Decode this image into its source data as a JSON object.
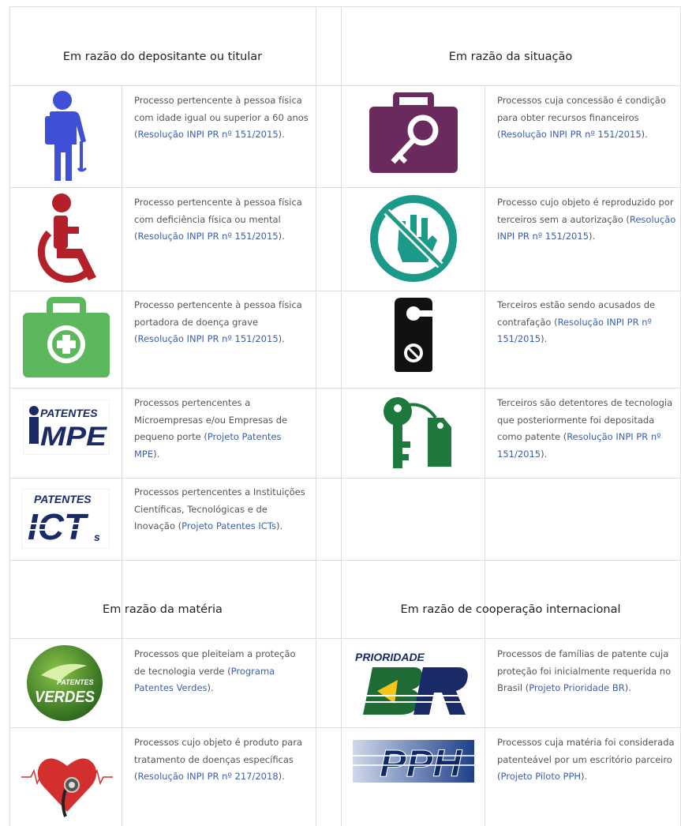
{
  "headers": {
    "depositante": "Em razão do depositante ou titular",
    "situacao": "Em razão da situação",
    "materia": "Em razão da matéria",
    "cooperacao": "Em razão de cooperação internacional"
  },
  "left_rows": [
    {
      "icon": "elderly-person-icon",
      "pre": "Processo pertencente à pessoa física com idade igual ou superior a 60 anos (",
      "link": "Resolução INPI PR nº 151/2015",
      "post": ")."
    },
    {
      "icon": "wheelchair-icon",
      "pre": "Processo pertencente à pessoa física com deficiência física ou mental (",
      "link": "Resolução INPI PR nº 151/2015",
      "post": ")."
    },
    {
      "icon": "medical-kit-icon",
      "pre": "Processo pertencente à pessoa física portadora de doença grave (",
      "link": "Resolução INPI PR nº 151/2015",
      "post": ")."
    },
    {
      "icon": "patentes-mpe-logo",
      "pre": "Processos pertencentes a Microempresas e/ou Empresas de pequeno porte (",
      "link": "Projeto Patentes MPE",
      "post": ")."
    },
    {
      "icon": "patentes-icts-logo",
      "pre": "Processos pertencentes a Instituições Científicas, Tecnológicas e de Inovação (",
      "link": "Projeto Patentes ICTs",
      "post": ")."
    }
  ],
  "right_rows": [
    {
      "icon": "briefcase-key-icon",
      "pre": "Processos cuja concessão é condição para obter recursos financeiros (",
      "link": "Resolução INPI PR nº 151/2015",
      "post": ")."
    },
    {
      "icon": "no-hand-icon",
      "pre": "Processo cujo objeto é reproduzido por terceiros sem a autorização (",
      "link": "Resolução INPI PR nº 151/2015",
      "post": ")."
    },
    {
      "icon": "door-hanger-icon",
      "pre": "Terceiros estão sendo acusados de contrafação (",
      "link": "Resolução INPI PR nº 151/2015",
      "post": ")."
    },
    {
      "icon": "key-tag-icon",
      "pre": "Terceiros são detentores de tecnologia que posteriormente foi depositada como patente (",
      "link": "Resolução INPI PR nº 151/2015",
      "post": ")."
    }
  ],
  "materia_rows": [
    {
      "icon": "patentes-verdes-logo",
      "pre": "Processos que pleiteiam a proteção de tecnologia verde (",
      "link": "Programa Patentes Verdes",
      "post": ")."
    },
    {
      "icon": "heart-stethoscope-icon",
      "pre": "Processos cujo objeto é produto para tratamento de doenças específicas (",
      "link": "Resolução INPI PR nº 217/2018",
      "post": ")."
    }
  ],
  "cooperacao_rows": [
    {
      "icon": "prioridade-br-logo",
      "pre": "Processos de famílias de patente cuja proteção foi inicialmente requerida no Brasil (",
      "link": "Projeto Prioridade BR",
      "post": ")."
    },
    {
      "icon": "pph-logo",
      "pre": "Processos cuja matéria foi considerada patenteável por um escritório parceiro (",
      "link": "Projeto Piloto PPH",
      "post": ")."
    }
  ],
  "logo_text": {
    "mpe_top": "PATENTES",
    "mpe_big": "MPE",
    "icts_top": "PATENTES",
    "icts_big": "ICTs",
    "verdes_top": "PATENTES",
    "verdes_big": "VERDES",
    "prioridade_top": "PRIORIDADE",
    "prioridade_big": "BR",
    "pph": "PPH"
  },
  "colors": {
    "link": "#3a5fb0",
    "blue_icon": "#3f4fd6",
    "red_icon": "#b3202a",
    "green_kit": "#5cb85c",
    "purple": "#6a2a5e",
    "teal": "#1b9a8a",
    "green_key": "#1e7a3c"
  }
}
